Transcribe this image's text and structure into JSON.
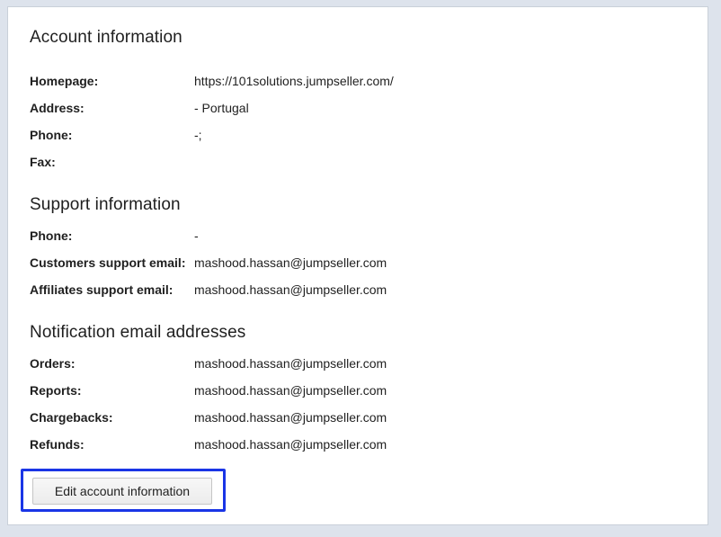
{
  "account": {
    "title": "Account information",
    "rows": [
      {
        "label": "Homepage:",
        "value": "https://101solutions.jumpseller.com/"
      },
      {
        "label": "Address:",
        "value": "- Portugal"
      },
      {
        "label": "Phone:",
        "value": "-;"
      },
      {
        "label": "Fax:",
        "value": ""
      }
    ]
  },
  "support": {
    "title": "Support information",
    "rows": [
      {
        "label": "Phone:",
        "value": "-"
      },
      {
        "label": "Customers support email:",
        "value": "mashood.hassan@jumpseller.com"
      },
      {
        "label": "Affiliates support email:",
        "value": "mashood.hassan@jumpseller.com"
      }
    ]
  },
  "notifications": {
    "title": "Notification email addresses",
    "rows": [
      {
        "label": "Orders:",
        "value": "mashood.hassan@jumpseller.com"
      },
      {
        "label": "Reports:",
        "value": "mashood.hassan@jumpseller.com"
      },
      {
        "label": "Chargebacks:",
        "value": "mashood.hassan@jumpseller.com"
      },
      {
        "label": "Refunds:",
        "value": "mashood.hassan@jumpseller.com"
      }
    ]
  },
  "actions": {
    "edit_label": "Edit account information"
  },
  "colors": {
    "highlight": "#1a35e6",
    "background": "#dde3ec"
  }
}
